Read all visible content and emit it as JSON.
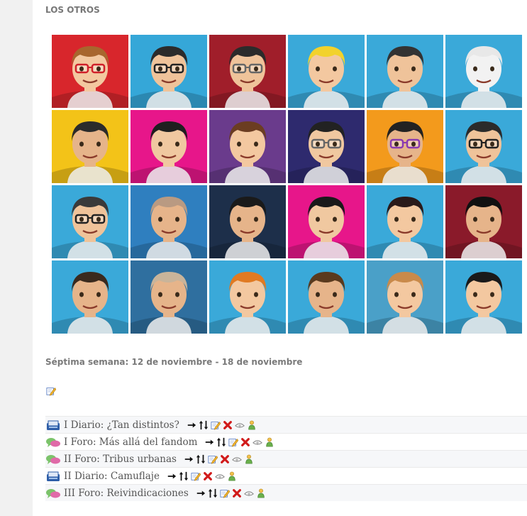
{
  "section": {
    "heading": "LOS OTROS"
  },
  "avatars": {
    "cells": [
      {
        "bg": "#d8262c",
        "hair": "#a8662e",
        "skin": "#f3c8a0",
        "glasses": "red",
        "name": "avatar-woman-red-glasses"
      },
      {
        "bg": "#35a7d8",
        "hair": "#2b2b2b",
        "skin": "#efc39a",
        "glasses": "black",
        "name": "avatar-man-glasses-thumb"
      },
      {
        "bg": "#a01e2a",
        "hair": "#2b2b2b",
        "skin": "#efc39a",
        "glasses": "gray",
        "name": "avatar-man-glasses-red-chair"
      },
      {
        "bg": "#3aa9d9",
        "hair": "#f2d22c",
        "skin": "#f3c8a0",
        "glasses": "none",
        "name": "avatar-blond-peace"
      },
      {
        "bg": "#3aa9d9",
        "hair": "#333333",
        "skin": "#efc39a",
        "glasses": "none",
        "name": "avatar-man-tie"
      },
      {
        "bg": "#3aa9d9",
        "hair": "#e8e8e8",
        "skin": "#f2f2f2",
        "glasses": "none",
        "name": "avatar-cat-mask"
      },
      {
        "bg": "#f3c318",
        "hair": "#2b2b2b",
        "skin": "#e6b48a",
        "glasses": "none",
        "name": "avatar-man-grin"
      },
      {
        "bg": "#e7168a",
        "hair": "#1f1f1f",
        "skin": "#f0c8a0",
        "glasses": "none",
        "name": "avatar-woman-dark-hair"
      },
      {
        "bg": "#6a3b8c",
        "hair": "#6b3d22",
        "skin": "#f3c8a0",
        "glasses": "none",
        "name": "avatar-woman-brown-hair"
      },
      {
        "bg": "#2e2a6e",
        "hair": "#222222",
        "skin": "#f0c8a0",
        "glasses": "gray",
        "name": "avatar-woman-sunglasses"
      },
      {
        "bg": "#f39a1c",
        "hair": "#222222",
        "skin": "#e6b48a",
        "glasses": "purple",
        "name": "avatar-man-beard-glasses"
      },
      {
        "bg": "#3aa9d9",
        "hair": "#2b2b2b",
        "skin": "#efc39a",
        "glasses": "black",
        "name": "avatar-man-sunglasses-thumb"
      },
      {
        "bg": "#3aa9d9",
        "hair": "#3a3a3a",
        "skin": "#efc39a",
        "glasses": "black",
        "name": "avatar-man-grin-glasses"
      },
      {
        "bg": "#2f7fbf",
        "hair": "#b99a82",
        "skin": "#e6b48a",
        "glasses": "none",
        "name": "avatar-bald-man-suit"
      },
      {
        "bg": "#1d2f4a",
        "hair": "#1a1a1a",
        "skin": "#e6b48a",
        "glasses": "none",
        "name": "avatar-man-night"
      },
      {
        "bg": "#e7168a",
        "hair": "#1a1a1a",
        "skin": "#f0c8a0",
        "glasses": "none",
        "name": "avatar-woman-pink-bg"
      },
      {
        "bg": "#3aa9d9",
        "hair": "#2a1a1a",
        "skin": "#f3c8a0",
        "glasses": "none",
        "name": "avatar-woman-curly-peace"
      },
      {
        "bg": "#8a1a2a",
        "hair": "#111111",
        "skin": "#e6b48a",
        "glasses": "none",
        "name": "avatar-woman-red-lips"
      },
      {
        "bg": "#3aa9d9",
        "hair": "#3a2a1e",
        "skin": "#e6b48a",
        "glasses": "none",
        "name": "avatar-man-park"
      },
      {
        "bg": "#2f6f9f",
        "hair": "#c9b49a",
        "skin": "#e6b48a",
        "glasses": "none",
        "name": "avatar-bearded-man"
      },
      {
        "bg": "#3aa9d9",
        "hair": "#e07a22",
        "skin": "#f3c8a0",
        "glasses": "none",
        "name": "avatar-curly-orange"
      },
      {
        "bg": "#3aa9d9",
        "hair": "#5a3a1e",
        "skin": "#e6b48a",
        "glasses": "none",
        "name": "avatar-man-long-hair"
      },
      {
        "bg": "#4aa0c8",
        "hair": "#c98a4a",
        "skin": "#f3c8a0",
        "glasses": "none",
        "name": "avatar-man-stadium"
      },
      {
        "bg": "#3aa9d9",
        "hair": "#1a1a1a",
        "skin": "#f3c8a0",
        "glasses": "none",
        "name": "avatar-woman-black-hair"
      }
    ]
  },
  "week": {
    "label": "Séptima semana: 12 de noviembre - 18 de noviembre"
  },
  "activities": [
    {
      "label": "I Diario: ¿Tan distintos?",
      "type": "journal"
    },
    {
      "label": "I Foro: Más allá del fandom",
      "type": "forum"
    },
    {
      "label": "II Foro: Tribus urbanas",
      "type": "forum"
    },
    {
      "label": "II Diario: Camuflaje",
      "type": "journal"
    },
    {
      "label": "III Foro: Reivindicaciones",
      "type": "forum"
    }
  ],
  "icons": {
    "journal": "journal-icon",
    "forum": "forum-icon",
    "tools": [
      "move-right-icon",
      "move-updown-icon",
      "edit-icon",
      "delete-icon",
      "hide-icon",
      "assign-role-icon"
    ]
  },
  "colors": {
    "sidebar": "#f1f1f1",
    "row_alt": "#f6f7f9",
    "text": "#555555",
    "heading": "#777777"
  }
}
